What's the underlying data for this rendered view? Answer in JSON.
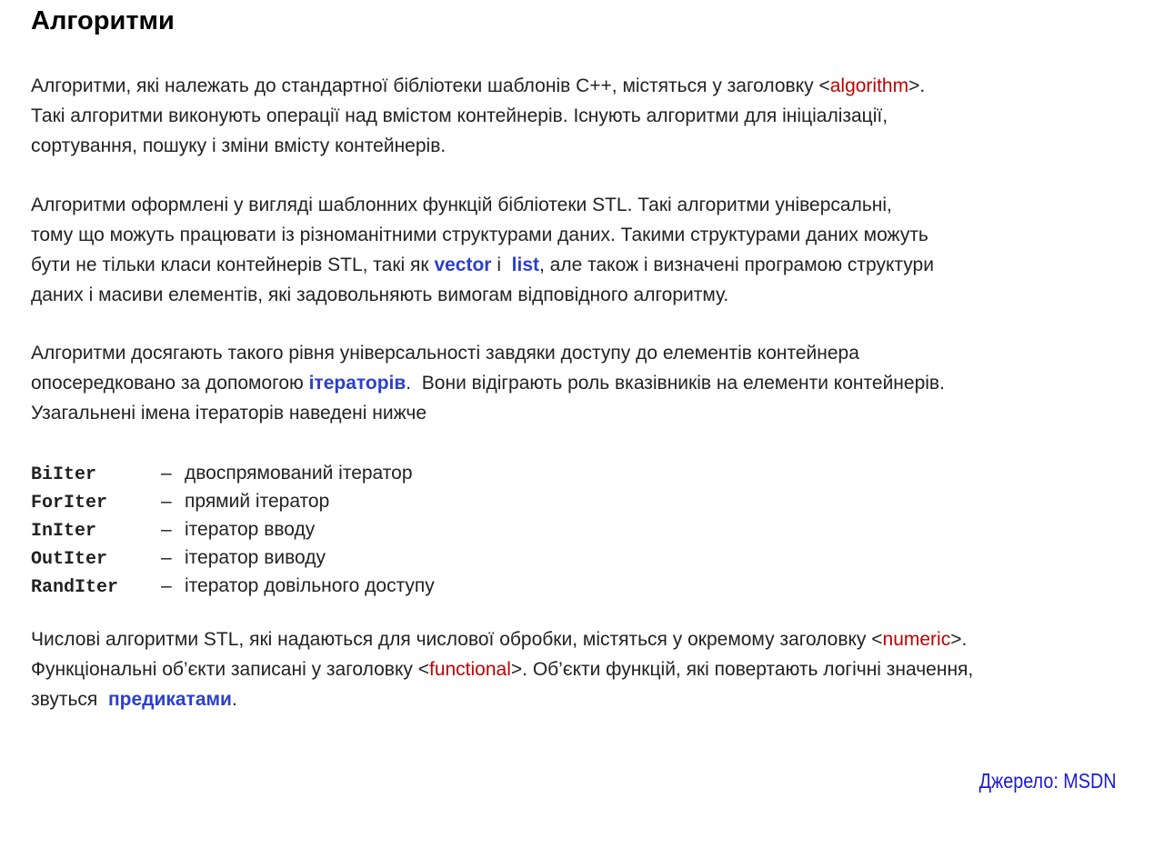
{
  "title": "Алгоритми",
  "paragraph1": {
    "line1_pre": "Алгоритми, які належать до стандартної бібліотеки шаблонів C++, містяться у заголовку <",
    "line1_code": "algorithm",
    "line1_post": ">.",
    "line2": "Такі алгоритми виконують операції над вмістом контейнерів. Існують алгоритми для ініціалізації,",
    "line3": "сортування, пошуку і зміни вмісту контейнерів."
  },
  "paragraph2": {
    "line1": "Алгоритми оформлені у вигляді шаблонних функцій бібліотеки STL.  Такі алгоритми  універсальні,",
    "line2": "тому що можуть працювати із різноманітними структурами даних. Такими структурами даних можуть",
    "line3_pre": "бути не тільки класи контейнерів STL, такі як ",
    "line3_vector": "vector",
    "line3_mid": " і  ",
    "line3_list": "list",
    "line3_post": ", але також і визначені програмою структури",
    "line4": "даних і масиви елементів, які задовольняють вимогам відповідного алгоритму."
  },
  "paragraph3": {
    "line1": "Алгоритми досягають такого рівня універсальності завдяки доступу до елементів контейнера",
    "line2_pre": "опосередковано за допомогою ",
    "line2_term": "ітераторів",
    "line2_post": ".  Вони відіграють роль вказівників на елементи контейнерів.",
    "line3": "Узагальнені імена ітераторів наведені нижче"
  },
  "iterators": [
    {
      "name": "BiIter",
      "dash": "–",
      "desc": "двоспрямований ітератор"
    },
    {
      "name": "ForIter",
      "dash": "–",
      "desc": "прямий ітератор"
    },
    {
      "name": "InIter",
      "dash": "–",
      "desc": "ітератор вводу"
    },
    {
      "name": "OutIter",
      "dash": "–",
      "desc": "ітератор виводу"
    },
    {
      "name": "RandIter",
      "dash": "–",
      "desc": "ітератор довільного доступу"
    }
  ],
  "paragraph4": {
    "line1_pre": "Числові алгоритми STL, які надаються для числової обробки, містяться у окремому заголовку <",
    "line1_code": "numeric",
    "line1_post": ">.",
    "line2_pre": "Функціональні об’єкти записані у заголовку <",
    "line2_code": "functional",
    "line2_post": ">. Об’єкти функцій, які повертають логічні значення,",
    "line3_pre": "звуться  ",
    "line3_term": "предикатами",
    "line3_post": "."
  },
  "source": "Джерело: MSDN",
  "colors": {
    "code_red": "#c00000",
    "term_blue": "#2b3fd0",
    "source_blue": "#1a1adb"
  }
}
